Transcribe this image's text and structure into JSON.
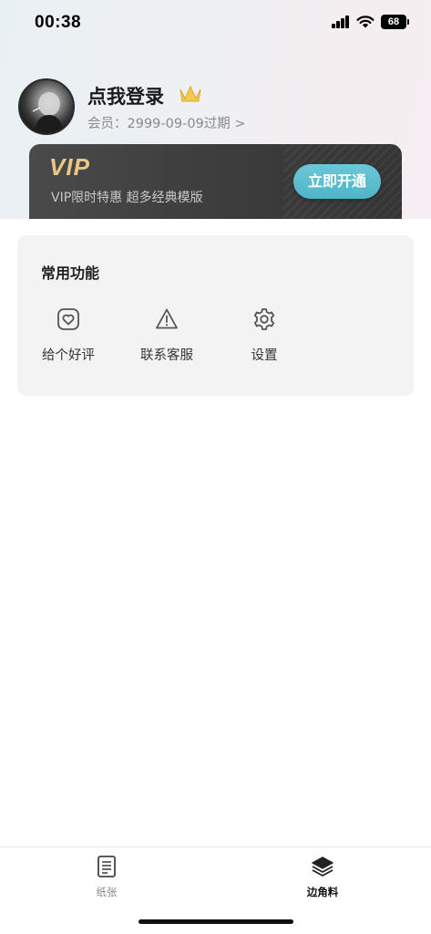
{
  "status_bar": {
    "time": "00:38",
    "battery": "68"
  },
  "profile": {
    "name": "点我登录",
    "member_line": "会员：2999-09-09过期 >"
  },
  "vip": {
    "logo": "VIP",
    "promo": "VIP限时特惠 超多经典模版",
    "button": "立即开通"
  },
  "functions": {
    "title": "常用功能",
    "items": [
      {
        "label": "给个好评",
        "icon": "heart-badge-icon"
      },
      {
        "label": "联系客服",
        "icon": "warning-triangle-icon"
      },
      {
        "label": "设置",
        "icon": "gear-icon"
      }
    ]
  },
  "tabbar": {
    "items": [
      {
        "label": "纸张",
        "icon": "document-list-icon",
        "active": false
      },
      {
        "label": "边角料",
        "icon": "layers-icon",
        "active": true
      }
    ]
  },
  "colors": {
    "vip_gold": "#e9c887",
    "vip_button": "#52b8cc",
    "card_bg": "#f3f3f3",
    "inactive_tab": "#888888",
    "active_tab": "#111111"
  }
}
